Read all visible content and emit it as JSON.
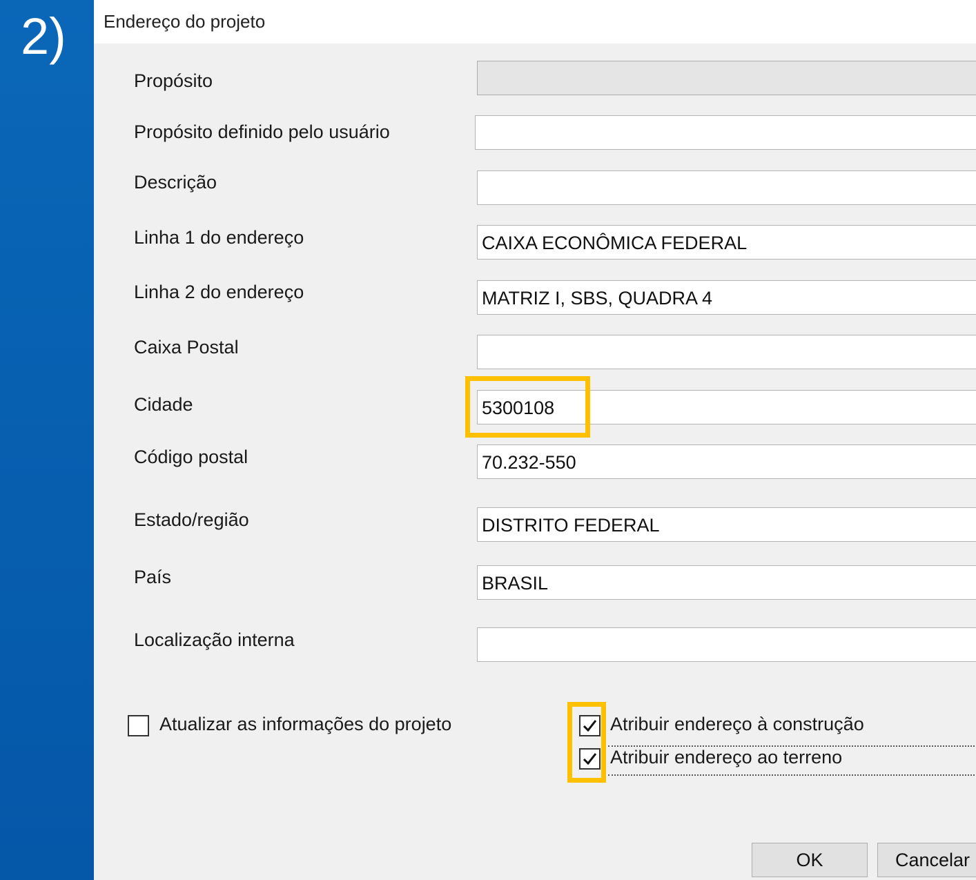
{
  "step_label": "2)",
  "dialog": {
    "title": "Endereço do projeto",
    "fields": [
      {
        "label": "Propósito",
        "value": "",
        "kind": "combo"
      },
      {
        "label": "Propósito definido pelo usuário",
        "value": ""
      },
      {
        "label": "Descrição",
        "value": ""
      },
      {
        "label": "Linha 1 do endereço",
        "value": "CAIXA ECONÔMICA FEDERAL"
      },
      {
        "label": "Linha 2 do endereço",
        "value": "MATRIZ I, SBS, QUADRA 4"
      },
      {
        "label": "Caixa Postal",
        "value": ""
      },
      {
        "label": "Cidade",
        "value": "5300108"
      },
      {
        "label": "Código postal",
        "value": "70.232-550"
      },
      {
        "label": "Estado/região",
        "value": "DISTRITO FEDERAL"
      },
      {
        "label": "País",
        "value": "BRASIL"
      },
      {
        "label": "Localização interna",
        "value": ""
      }
    ],
    "checkboxes": {
      "update_project": {
        "label": "Atualizar as informações do projeto",
        "checked": false
      },
      "assign_building": {
        "label": "Atribuir endereço à construção",
        "checked": true
      },
      "assign_site": {
        "label": "Atribuir endereço ao terreno",
        "checked": true
      }
    },
    "buttons": {
      "ok": "OK",
      "cancel": "Cancelar"
    }
  },
  "highlight_color": "#ffc000",
  "sidebar_color": "#0a67b8"
}
